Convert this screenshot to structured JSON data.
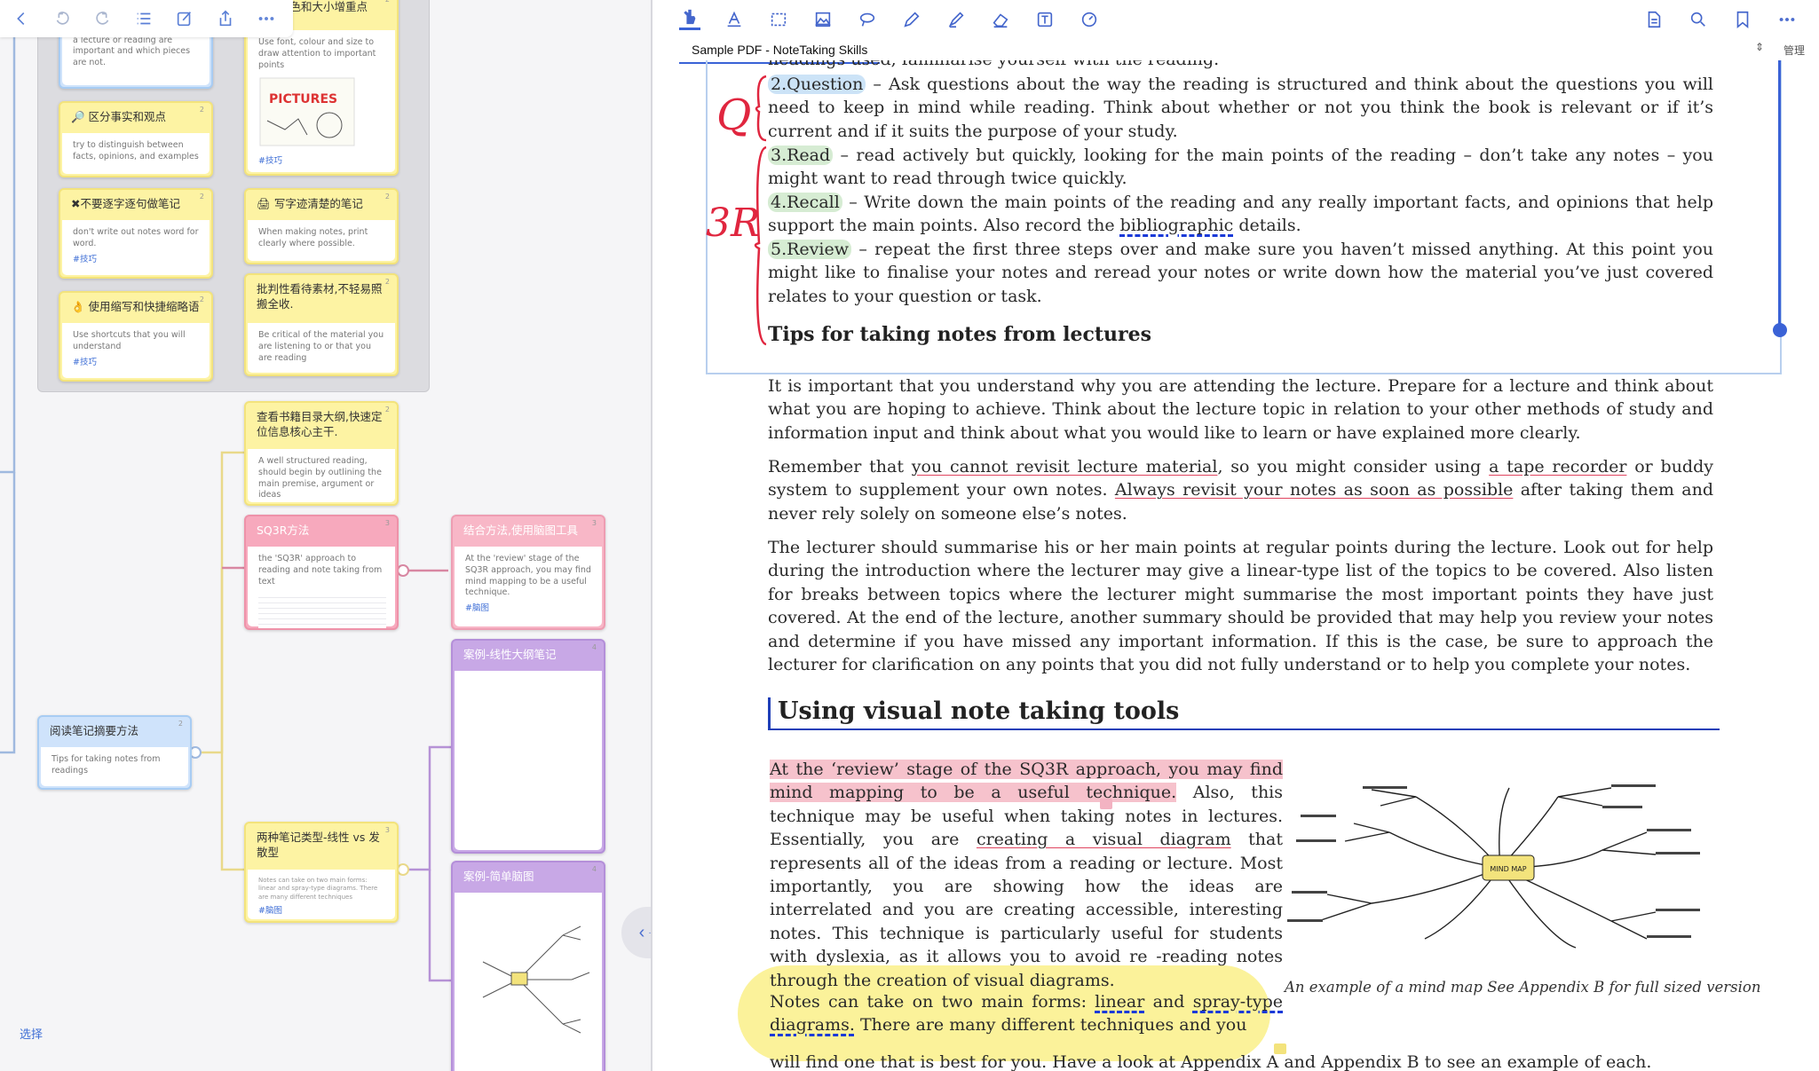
{
  "left_toolbar": {
    "icons": [
      "back-icon",
      "undo-icon",
      "redo-icon",
      "list-icon",
      "edit-icon",
      "share-icon",
      "more-icon"
    ]
  },
  "mindmap": {
    "root": {
      "title": "阅读笔记摘要方法",
      "desc": "Tips for taking notes from readings",
      "num": "2"
    },
    "group_cards": [
      {
        "title": "",
        "desc": "It is important to determine which pieces of information in a lecture or reading are important and which pieces are not.",
        "num": "",
        "tag": ""
      },
      {
        "title": "字体颜色和大小增重点",
        "desc": "Use font, colour and size to draw attention to important points",
        "num": "2",
        "tag": "#技巧"
      },
      {
        "title": "🔎 区分事实和观点",
        "desc": "try to distinguish between facts, opinions, and examples",
        "num": "2",
        "tag": ""
      },
      {
        "title": "✖不要逐字逐句做笔记",
        "desc": "don't write out notes word for word.",
        "num": "2",
        "tag": "#技巧"
      },
      {
        "title": "🖨 写字迹清楚的笔记",
        "desc": "When making notes, print clearly where possible.",
        "num": "2",
        "tag": ""
      },
      {
        "title": "👌 使用缩写和快捷缩略语",
        "desc": "Use shortcuts that you will understand",
        "num": "2",
        "tag": "#技巧"
      },
      {
        "title": "批判性看待素材,不轻易照搬全收.",
        "desc": "Be critical of the material you are listening to or that you are reading",
        "num": "2",
        "tag": ""
      }
    ],
    "outline_card": {
      "title": "查看书籍目录大纲,快速定位信息核心主干.",
      "desc": "A well structured reading, should begin by outlining the main premise, argument or ideas",
      "num": "2"
    },
    "sq3r_card": {
      "title": "SQ3R方法",
      "desc": "the 'SQ3R' approach to reading and note taking from text",
      "num": "3"
    },
    "combine_card": {
      "title": "结合方法,使用脑图工具",
      "desc": "At the 'review' stage of the SQ3R approach, you may find mind mapping to be a useful technique.",
      "num": "3",
      "tag": "#脑图"
    },
    "types_card": {
      "title": "两种笔记类型-线性 vs 发散型",
      "desc": "Notes can take on two main forms: linear and spray-type diagrams. There are many different techniques",
      "num": "3",
      "tag": "#脑图"
    },
    "example1": {
      "title": "案例-线性大纲笔记",
      "num": "4"
    },
    "example2": {
      "title": "案例-简单脑图",
      "num": "4"
    },
    "select_label": "选择"
  },
  "pdf": {
    "tab_title": "Sample PDF - NoteTaking Skills",
    "manage_label": "管理",
    "toolbar_icons": [
      "hand-icon",
      "text-highlight-icon",
      "rect-select-icon",
      "image-select-icon",
      "lasso-icon",
      "pen-icon",
      "highlighter-icon",
      "eraser-icon",
      "textbox-icon",
      "ruler-icon"
    ],
    "toolbar_right_icons": [
      "document-icon",
      "search-icon",
      "bookmark-icon",
      "more-icon"
    ],
    "top_partial": "headings used, familiarise yourself with the reading.",
    "sq3r": [
      {
        "label": "2.Question",
        "text": " – Ask questions about the way the reading is structured and think about the questions you will need to keep in mind while reading. Think about whether or not you think the book is relevant or if it’s current and if it suits the purpose of your study."
      },
      {
        "label": "3.Read",
        "text": " – read actively but quickly, looking for the main points of the reading – don’t take any notes – you might want to read through twice quickly."
      },
      {
        "label": "4.Recall",
        "text_a": " – Write down the main points of the reading and any really important facts, and opinions that help support the main points. Also record the ",
        "link": "bibliographic",
        "text_b": " details."
      },
      {
        "label": "5.Review",
        "text": " – repeat the first three steps over and make sure you haven’t missed anything. At this point you might like to finalise your notes and reread your notes or write down how the material you’ve just covered relates to your question or task."
      }
    ],
    "hand_q": "Q",
    "hand_3r": "3R",
    "tips_heading": "Tips for taking notes from lectures",
    "para1": "It is important that you understand why you are attending the lecture. Prepare for a lecture and think about what you are hoping to achieve. Think about the lecture topic in relation to your other methods of study and information input and think about what you would like to learn or have explained more clearly.",
    "para2": {
      "a": "Remember that ",
      "u1": "you cannot revisit lecture material",
      "b": ", so you might consider using ",
      "u2": "a tape recorder",
      "c": " or buddy system to supplement your own notes. ",
      "u3": "Always revisit your notes as soon as possible",
      "d": " after taking them and never rely solely on someone else’s notes."
    },
    "para3": "The lecturer should summarise his or her main points at regular points during the lecture. Look out for help during the introduction where the lecturer may give a linear-type list of the topics to be covered. Also listen for breaks between topics where the lecturer might summarise the most important points they have just covered. At the end of the lecture, another summary should be provided that may help you review your notes and determine if you have missed any important information. If this is the case, be sure to approach the lecturer for clarification on any points that you did not fully understand or to help you complete your notes.",
    "visual_heading": "Using visual note taking tools",
    "para4": {
      "hl": "At the ‘review’ stage of the SQ3R approach, you may find mind mapping to be a useful technique.",
      "a": " Also, this technique may be useful when taking notes in lectures. Essentially, you are ",
      "u1": "creating a visual diagram",
      "b": " that represents all of the ideas from a reading or lecture. Most importantly, you are showing how the ideas are interrelated and you are creating accessible, interesting notes. This technique is particularly useful for students with dyslexia, as it allows you to avoid re -reading notes through the creation of visual diagrams."
    },
    "para5": {
      "a": "Notes can take on two main forms: ",
      "u1": "linear",
      "b": " and ",
      "u2": "spray-type diagrams.",
      "c": " There are many different techniques and you"
    },
    "para6": "will find one that is best for you. Have a look at Appendix A and Appendix B to see an example of each.",
    "caption": "An example of a mind map See Appendix B for full sized version",
    "mindmap_center": "MIND MAP"
  }
}
